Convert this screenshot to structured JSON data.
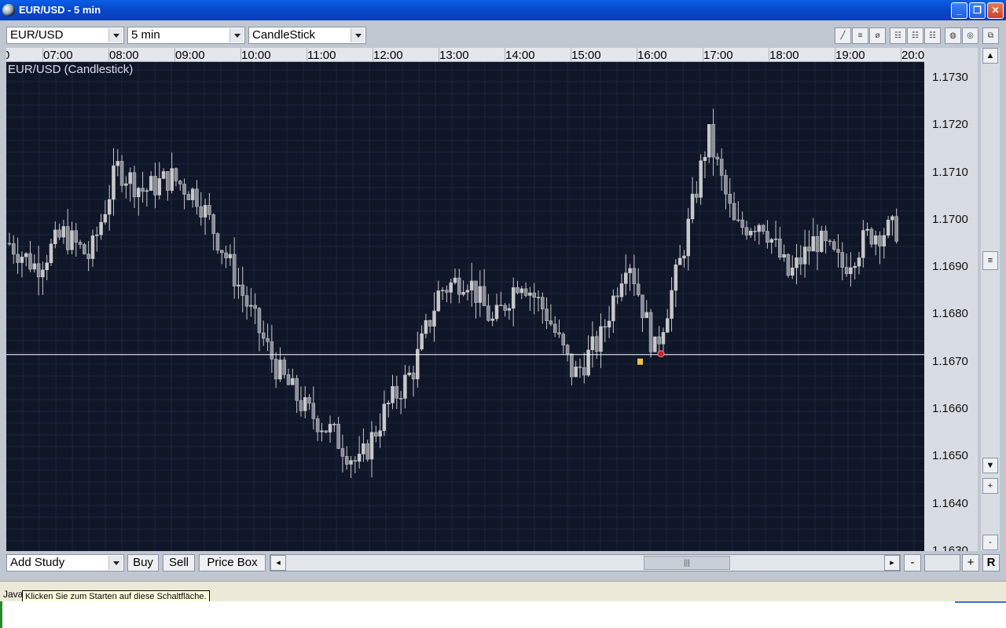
{
  "window": {
    "title": "EUR/USD - 5 min"
  },
  "toolbar": {
    "symbol": "EUR/USD",
    "interval": "5 min",
    "chart_type": "CandleStick"
  },
  "chart": {
    "title": "EUR/USD (Candlestick)",
    "colors": {
      "background": "#0f1628",
      "grid": "#26324a",
      "candle": "#c8c8c8",
      "line": "#ffffff",
      "marker_red": "#c0282a",
      "marker_yellow": "#f0c04a"
    }
  },
  "time_axis": {
    "labels": [
      "0",
      "07:00",
      "08:00",
      "09:00",
      "10:00",
      "11:00",
      "12:00",
      "13:00",
      "14:00",
      "15:00",
      "16:00",
      "17:00",
      "18:00",
      "19:00",
      "20:0"
    ]
  },
  "price_axis": {
    "labels": [
      "1.1730",
      "1.1720",
      "1.1710",
      "1.1700",
      "1.1690",
      "1.1680",
      "1.1670",
      "1.1660",
      "1.1650",
      "1.1640",
      "1.1630"
    ]
  },
  "horizontal_line": {
    "price": 1.16715
  },
  "chart_data": {
    "type": "candlestick",
    "title": "EUR/USD (Candlestick)",
    "x": [
      "07:00",
      "08:00",
      "09:00",
      "10:00",
      "11:00",
      "12:00",
      "13:00",
      "14:00",
      "15:00",
      "16:00",
      "17:00",
      "18:00",
      "19:00"
    ],
    "close_path": [
      1.1695,
      1.169,
      1.1697,
      1.1692,
      1.1711,
      1.1706,
      1.1709,
      1.1705,
      1.1693,
      1.168,
      1.1668,
      1.166,
      1.1655,
      1.1648,
      1.166,
      1.1668,
      1.1685,
      1.1688,
      1.1678,
      1.1688,
      1.168,
      1.1667,
      1.1675,
      1.1693,
      1.1672,
      1.1692,
      1.1718,
      1.1698,
      1.17,
      1.1688,
      1.1696,
      1.169,
      1.1697,
      1.1698
    ],
    "ylim": [
      1.163,
      1.1733
    ]
  },
  "bottom": {
    "add_study": "Add Study",
    "buy": "Buy",
    "sell": "Sell",
    "price_box": "Price Box",
    "zoom_out": "-",
    "zoom_in": "+",
    "reset": "R"
  },
  "status": {
    "java": "Java",
    "tooltip": "Klicken Sie zum Starten auf diese Schaltfläche."
  }
}
